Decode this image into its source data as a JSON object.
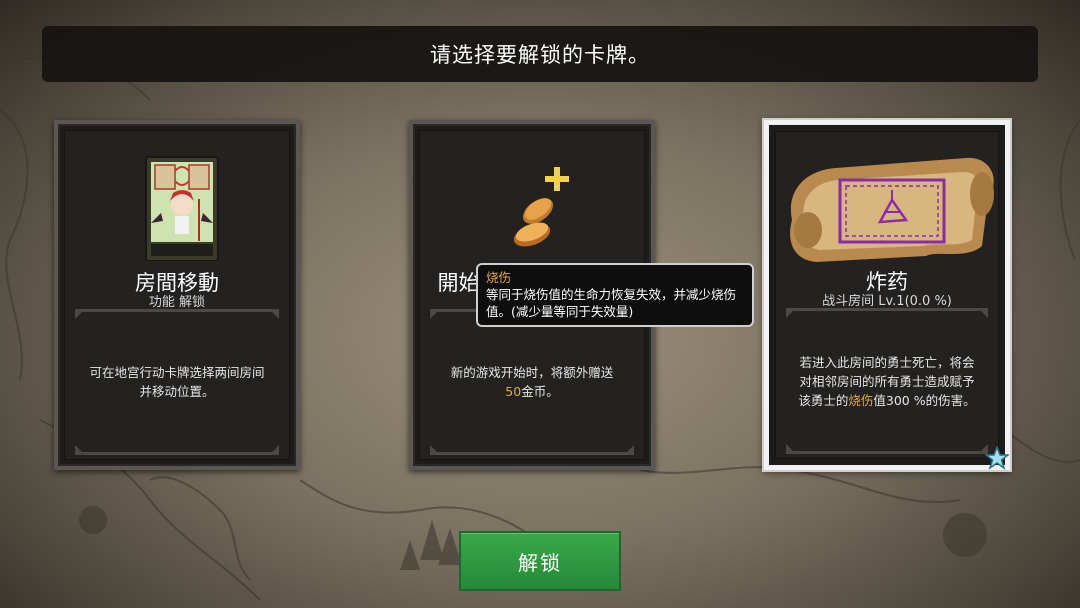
{
  "banner": {
    "text": "请选择要解锁的卡牌。"
  },
  "cards": [
    {
      "title": "房間移動",
      "subtitle": "功能 解锁",
      "desc": "可在地宫行动卡牌选择两间房间并移动位置。",
      "icon": "card-portrait-icon"
    },
    {
      "title": "開始時持有金幣增加",
      "desc_before": "新的游戏开始时，将额外赠送",
      "desc_highlight": "50",
      "desc_after": "金币。",
      "icon": "gold-coins-plus-icon"
    },
    {
      "title": "炸药",
      "subtitle": "战斗房间 Lv.1(0.0 %)",
      "desc_before": "若进入此房间的勇士死亡，将会对相邻房间的所有勇士造成赋予该勇士的",
      "desc_highlight": "烧伤",
      "desc_after": "值300 %的伤害。",
      "icon": "bomb-scroll-icon",
      "selected": true
    }
  ],
  "tooltip": {
    "title": "烧伤",
    "body": "等同于烧伤值的生命力恢复失效，并减少烧伤值。(减少量等同于失效量)"
  },
  "unlock_button": {
    "label": "解锁"
  },
  "colors": {
    "highlight": "#e2a93a",
    "button": "#2f9a41",
    "selected_border": "#f2f2f2"
  }
}
